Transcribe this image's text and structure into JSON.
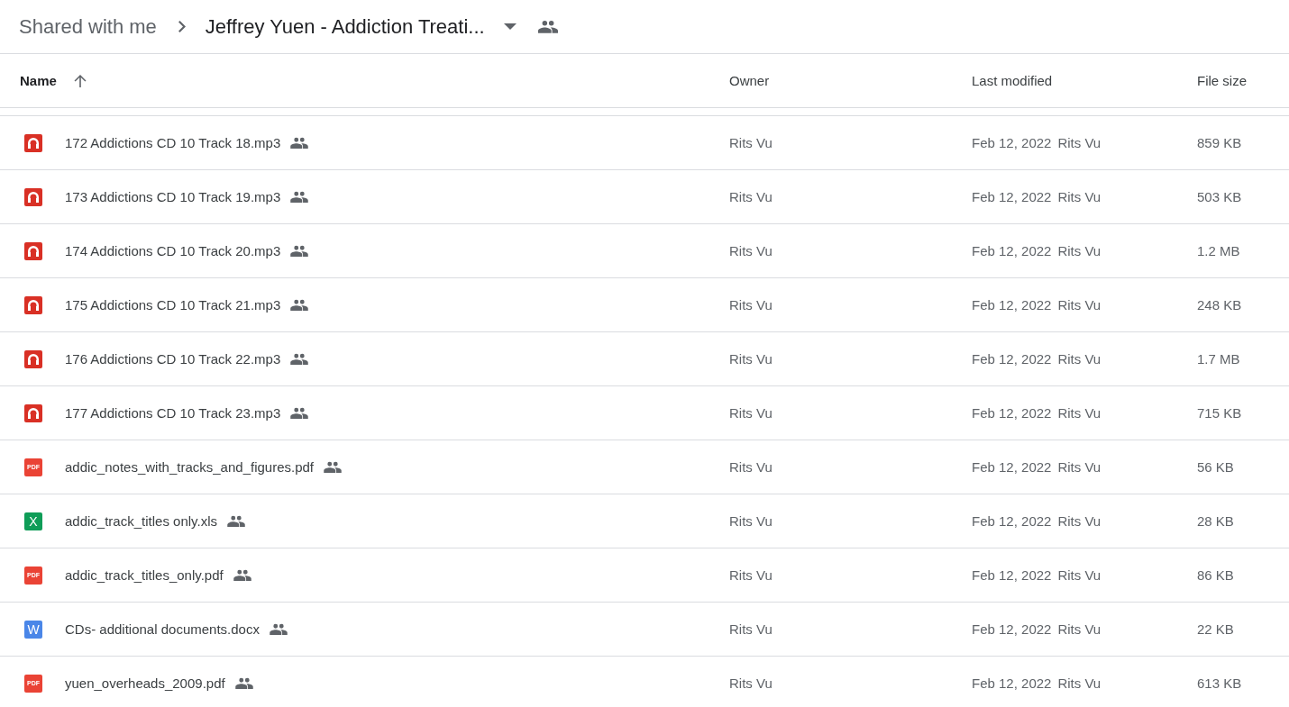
{
  "breadcrumb": {
    "parent": "Shared with me",
    "current": "Jeffrey Yuen - Addiction Treati...",
    "shared": true
  },
  "columns": [
    {
      "label": "Name",
      "sorted": true
    },
    {
      "label": "Owner",
      "sorted": false
    },
    {
      "label": "Last modified",
      "sorted": false
    },
    {
      "label": "File size",
      "sorted": false
    }
  ],
  "files": [
    {
      "kind": "audio",
      "name": "172 Addictions CD 10 Track 18.mp3",
      "shared": true,
      "owner": "Rits Vu",
      "modified": "Feb 12, 2022",
      "modified_by": "Rits Vu",
      "size": "859 KB"
    },
    {
      "kind": "audio",
      "name": "173 Addictions CD 10 Track 19.mp3",
      "shared": true,
      "owner": "Rits Vu",
      "modified": "Feb 12, 2022",
      "modified_by": "Rits Vu",
      "size": "503 KB"
    },
    {
      "kind": "audio",
      "name": "174 Addictions CD 10 Track 20.mp3",
      "shared": true,
      "owner": "Rits Vu",
      "modified": "Feb 12, 2022",
      "modified_by": "Rits Vu",
      "size": "1.2 MB"
    },
    {
      "kind": "audio",
      "name": "175 Addictions CD 10 Track 21.mp3",
      "shared": true,
      "owner": "Rits Vu",
      "modified": "Feb 12, 2022",
      "modified_by": "Rits Vu",
      "size": "248 KB"
    },
    {
      "kind": "audio",
      "name": "176 Addictions CD 10 Track 22.mp3",
      "shared": true,
      "owner": "Rits Vu",
      "modified": "Feb 12, 2022",
      "modified_by": "Rits Vu",
      "size": "1.7 MB"
    },
    {
      "kind": "audio",
      "name": "177 Addictions CD 10 Track 23.mp3",
      "shared": true,
      "owner": "Rits Vu",
      "modified": "Feb 12, 2022",
      "modified_by": "Rits Vu",
      "size": "715 KB"
    },
    {
      "kind": "pdf",
      "badge": "PDF",
      "name": "addic_notes_with_tracks_and_figures.pdf",
      "shared": true,
      "owner": "Rits Vu",
      "modified": "Feb 12, 2022",
      "modified_by": "Rits Vu",
      "size": "56 KB"
    },
    {
      "kind": "sheet",
      "badge": "X",
      "name": "addic_track_titles only.xls",
      "shared": true,
      "owner": "Rits Vu",
      "modified": "Feb 12, 2022",
      "modified_by": "Rits Vu",
      "size": "28 KB"
    },
    {
      "kind": "pdf",
      "badge": "PDF",
      "name": "addic_track_titles_only.pdf",
      "shared": true,
      "owner": "Rits Vu",
      "modified": "Feb 12, 2022",
      "modified_by": "Rits Vu",
      "size": "86 KB"
    },
    {
      "kind": "doc",
      "badge": "W",
      "name": "CDs- additional documents.docx",
      "shared": true,
      "owner": "Rits Vu",
      "modified": "Feb 12, 2022",
      "modified_by": "Rits Vu",
      "size": "22 KB"
    },
    {
      "kind": "pdf",
      "badge": "PDF",
      "name": "yuen_overheads_2009.pdf",
      "shared": true,
      "owner": "Rits Vu",
      "modified": "Feb 12, 2022",
      "modified_by": "Rits Vu",
      "size": "613 KB"
    }
  ]
}
